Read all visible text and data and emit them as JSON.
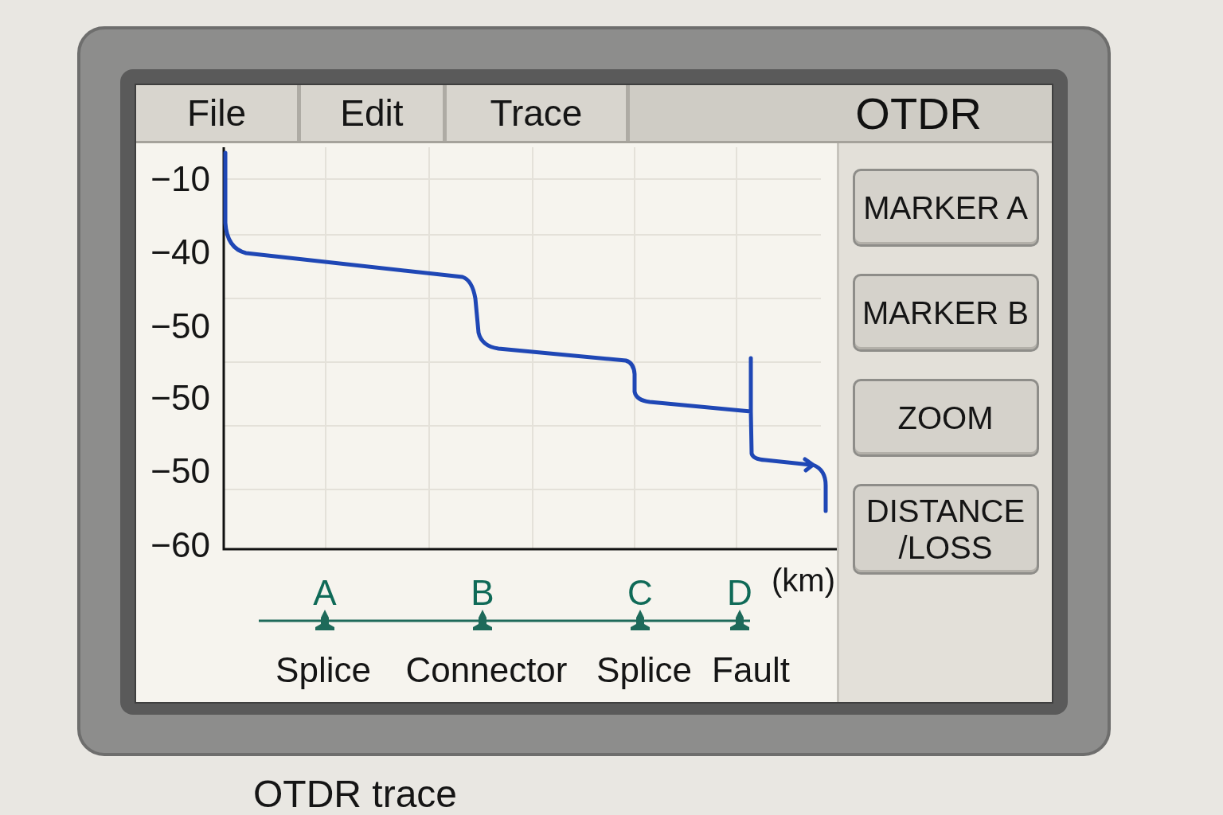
{
  "menu": [
    {
      "label": "File"
    },
    {
      "label": "Edit"
    },
    {
      "label": "Trace"
    }
  ],
  "title": "OTDR",
  "chart": {
    "y_labels": [
      "−10",
      "−40",
      "−50",
      "−50",
      "−50",
      "−60"
    ],
    "x_unit": "(km)",
    "events": [
      {
        "letter": "A",
        "label": "Splice"
      },
      {
        "letter": "B",
        "label": "Connector"
      },
      {
        "letter": "C",
        "label": "Splice"
      },
      {
        "letter": "D",
        "label": "Fault"
      }
    ]
  },
  "buttons": [
    {
      "label": "MARKER A"
    },
    {
      "label": "MARKER B"
    },
    {
      "label": "ZOOM"
    },
    {
      "label": "DISTANCE\n/LOSS"
    }
  ],
  "caption": "OTDR trace"
}
